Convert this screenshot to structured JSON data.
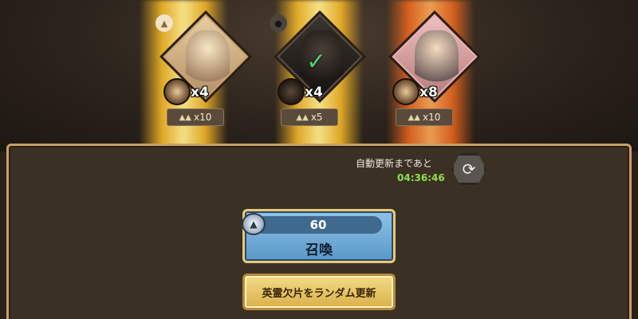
{
  "cards": [
    {
      "multiplier": "x4",
      "cost": "x10",
      "style": "light",
      "selected": false
    },
    {
      "multiplier": "x4",
      "cost": "x5",
      "style": "dark",
      "selected": true
    },
    {
      "multiplier": "x8",
      "cost": "x10",
      "style": "pink",
      "selected": false
    }
  ],
  "refresh": {
    "label": "自動更新まであと",
    "timer": "04:36:46"
  },
  "summon": {
    "cost": "60",
    "label": "召喚"
  },
  "random_refresh": {
    "label": "英霊欠片をランダム更新"
  },
  "colors": {
    "gold_beam": "#ffc828",
    "red_beam": "#ff6e1e",
    "timer": "#8ee04a",
    "summon_button": "#6aa6d4",
    "random_button": "#e6c35e"
  }
}
